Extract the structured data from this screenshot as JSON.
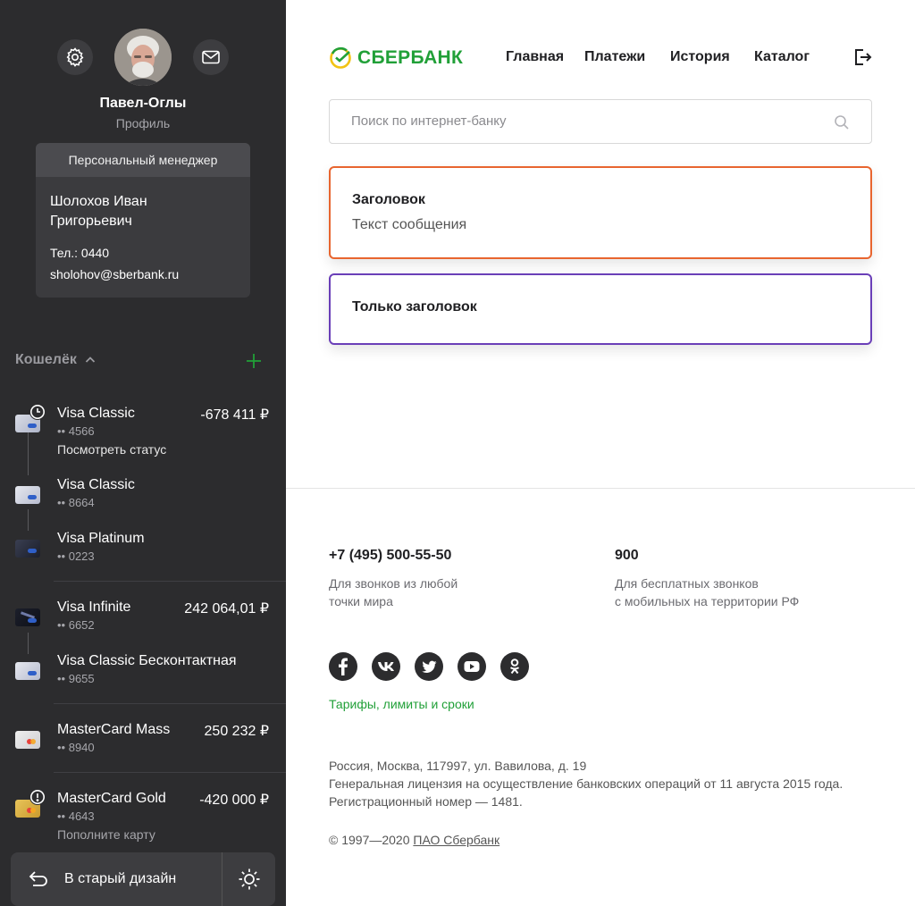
{
  "profile": {
    "name": "Павел-Оглы",
    "subtitle": "Профиль"
  },
  "manager": {
    "header": "Персональный менеджер",
    "name": "Шолохов Иван Григорьевич",
    "phone": "Тел.: 0440",
    "email": "sholohov@sberbank.ru"
  },
  "wallet": {
    "title": "Кошелёк",
    "cards": [
      {
        "name": "Visa Classic",
        "number": "•• 4566",
        "amount": "-678 411 ₽",
        "note": "Посмотреть статус",
        "badge": "clock"
      },
      {
        "name": "Visa Classic",
        "number": "•• 8664",
        "amount": "",
        "note": ""
      },
      {
        "name": "Visa Platinum",
        "number": "•• 0223",
        "amount": "",
        "note": ""
      },
      {
        "name": "Visa Infinite",
        "number": "•• 6652",
        "amount": "242 064,01 ₽",
        "note": ""
      },
      {
        "name": "Visa Classic Бесконтактная",
        "number": "•• 9655",
        "amount": "",
        "note": ""
      },
      {
        "name": "MasterCard Mass",
        "number": "•• 8940",
        "amount": "250 232 ₽",
        "note": ""
      },
      {
        "name": "MasterCard Gold",
        "number": "•• 4643",
        "amount": "-420 000 ₽",
        "note": "Пополните карту",
        "badge": "alert"
      }
    ]
  },
  "bottom": {
    "old_design": "В старый дизайн"
  },
  "header": {
    "logo": "СБЕРБАНК",
    "nav": [
      "Главная",
      "Платежи",
      "История",
      "Каталог"
    ]
  },
  "search": {
    "placeholder": "Поиск по интернет-банку"
  },
  "alerts": [
    {
      "title": "Заголовок",
      "text": "Текст сообщения",
      "color": "#e8652f"
    },
    {
      "title": "Только заголовок",
      "text": "",
      "color": "#6a3fb8"
    }
  ],
  "footer": {
    "phone1": "+7 (495) 500-55-50",
    "phone1_desc": "Для звонков из любой\nточки мира",
    "phone2": "900",
    "phone2_desc": "Для бесплатных звонков\nс мобильных на территории РФ",
    "social": [
      "facebook-icon",
      "vk-icon",
      "twitter-icon",
      "youtube-icon",
      "odnoklassniki-icon"
    ],
    "tariffs": "Тарифы, лимиты и сроки",
    "address": "Россия, Москва, 117997, ул. Вавилова, д. 19",
    "license": "Генеральная лицензия на осуществление банковских операций от 11 августа 2015 года.",
    "reg": "Регистрационный номер — 1481.",
    "copyright_prefix": "© 1997—2020 ",
    "copyright_link": "ПАО Сбербанк"
  },
  "colors": {
    "brand_green": "#21a038",
    "sidebar_bg": "#2c2c2e"
  }
}
